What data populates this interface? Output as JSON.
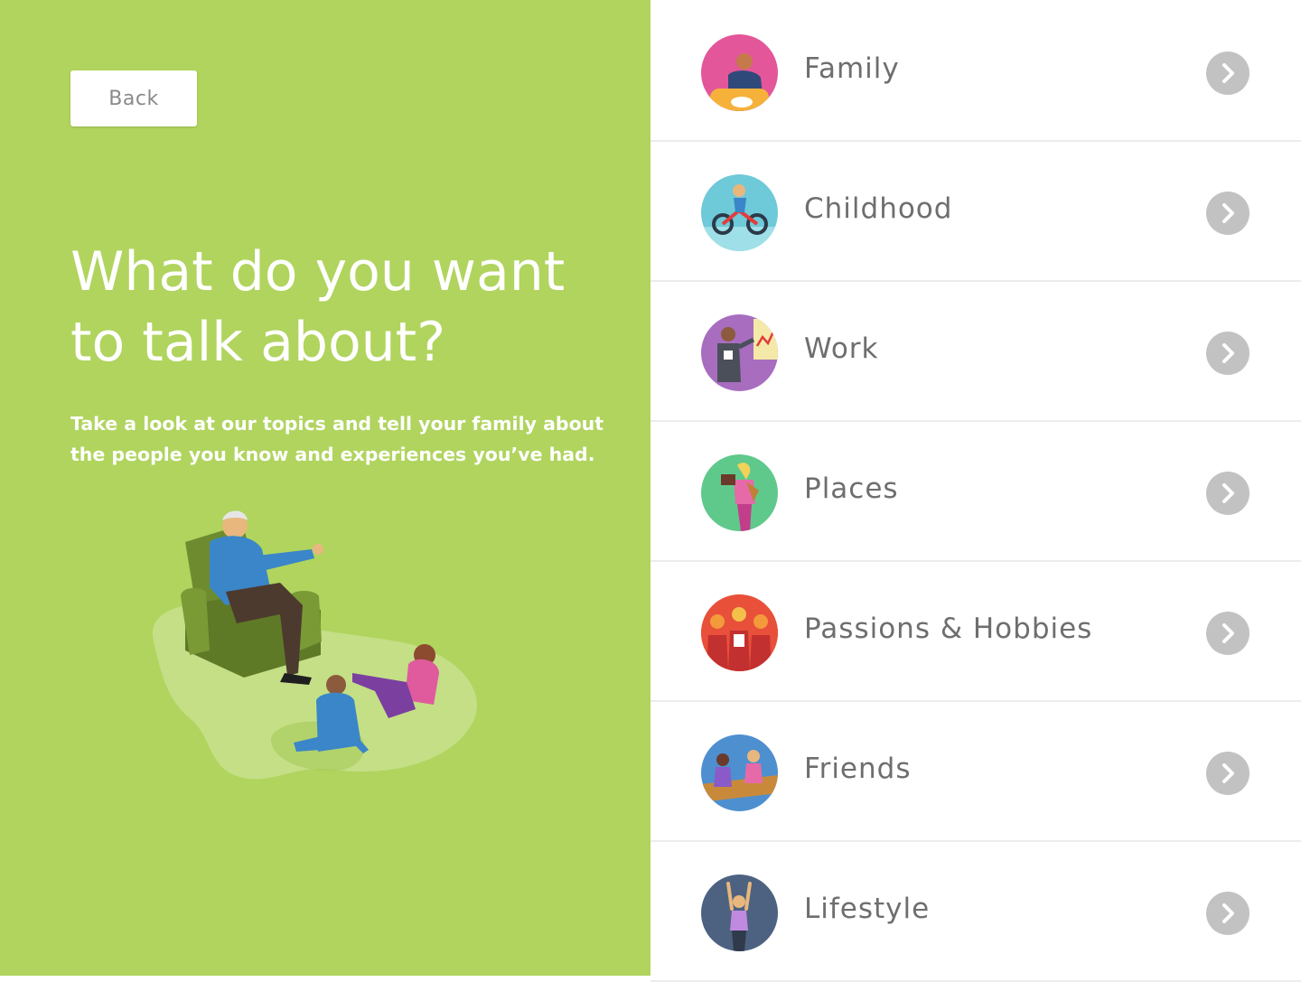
{
  "back_button": {
    "label": "Back"
  },
  "heading": {
    "line1": "What do you want",
    "line2": "to talk about?"
  },
  "intro": {
    "line1": "Take a look at our topics and tell your family about",
    "line2": "the people you know and experiences you’ve had."
  },
  "topics": [
    {
      "label": "Family",
      "icon": "family-thumbnail",
      "color": "#e4569a"
    },
    {
      "label": "Childhood",
      "icon": "childhood-thumbnail",
      "color": "#6ec9d8"
    },
    {
      "label": "Work",
      "icon": "work-thumbnail",
      "color": "#a86dbf"
    },
    {
      "label": "Places",
      "icon": "places-thumbnail",
      "color": "#5fc98c"
    },
    {
      "label": "Passions & Hobbies",
      "icon": "passions-thumbnail",
      "color": "#ef6f3a"
    },
    {
      "label": "Friends",
      "icon": "friends-thumbnail",
      "color": "#4e8fcf"
    },
    {
      "label": "Lifestyle",
      "icon": "lifestyle-thumbnail",
      "color": "#4d6281"
    }
  ],
  "colors": {
    "left_panel": "#b0d45e",
    "chevron": "#c2c2c2",
    "label_text": "#6e6e6e"
  }
}
